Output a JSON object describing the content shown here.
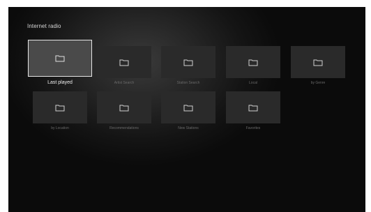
{
  "screen": {
    "title": "Internet radio",
    "tiles": [
      {
        "label": "Last played",
        "icon": "folder-icon",
        "selected": true
      },
      {
        "label": "Artist Search",
        "icon": "folder-icon",
        "selected": false
      },
      {
        "label": "Station Search",
        "icon": "folder-icon",
        "selected": false
      },
      {
        "label": "Local",
        "icon": "folder-icon",
        "selected": false
      },
      {
        "label": "by Genre",
        "icon": "folder-icon",
        "selected": false
      },
      {
        "label": "by Location",
        "icon": "folder-icon",
        "selected": false
      },
      {
        "label": "Recommendations",
        "icon": "folder-icon",
        "selected": false
      },
      {
        "label": "New Stations",
        "icon": "folder-icon",
        "selected": false
      },
      {
        "label": "Favorites",
        "icon": "folder-icon",
        "selected": false
      }
    ]
  }
}
